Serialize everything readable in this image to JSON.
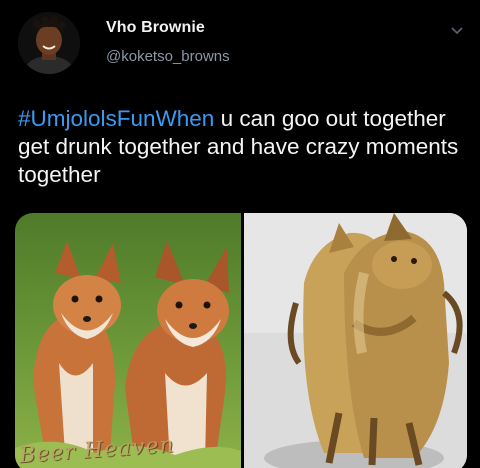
{
  "tweet": {
    "display_name": "Vho Brownie",
    "handle": "@koketso_browns",
    "hashtag": "#UmjololsFunWhen",
    "text": " u can goo out together get drunk together and have crazy moments together",
    "options_icon": "chevron-down-icon"
  },
  "media": {
    "left_image": "two-fox-cubs-photo",
    "right_image": "two-taxidermy-foxes-hugging-photo",
    "watermark": "Beer Heaven"
  },
  "colors": {
    "background": "#000000",
    "hashtag": "#3b9af2",
    "handle": "#8b98a5"
  }
}
